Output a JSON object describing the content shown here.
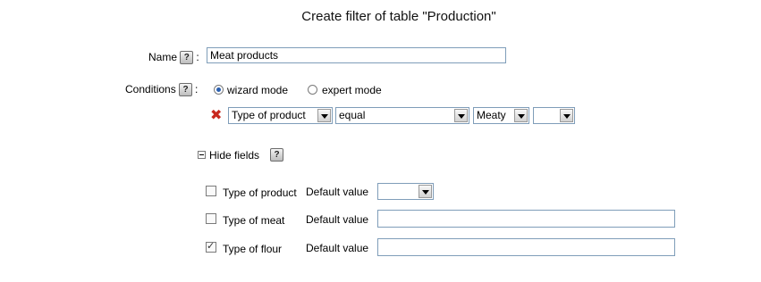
{
  "title": "Create filter of table \"Production\"",
  "help_glyph": "?",
  "name_field": {
    "label": "Name",
    "value": "Meat products"
  },
  "conditions": {
    "label": "Conditions",
    "modes": [
      {
        "label": "wizard mode",
        "selected": true
      },
      {
        "label": "expert mode",
        "selected": false
      }
    ],
    "rule": {
      "delete_glyph": "✖",
      "field": "Type of product",
      "operator": "equal",
      "value": "Meaty",
      "extra": ""
    }
  },
  "hide_fields": {
    "label": "Hide fields"
  },
  "fields": [
    {
      "label": "Type of product",
      "checked": false,
      "default_label": "Default value",
      "default_value": ""
    },
    {
      "label": "Type of meat",
      "checked": false,
      "default_label": "Default value",
      "default_value": ""
    },
    {
      "label": "Type of flour",
      "checked": true,
      "default_label": "Default value",
      "default_value": ""
    }
  ],
  "colors": {
    "delete_icon": "#c8281e",
    "input_border": "#7f9db9",
    "radio_dot": "#2a5fb0"
  }
}
